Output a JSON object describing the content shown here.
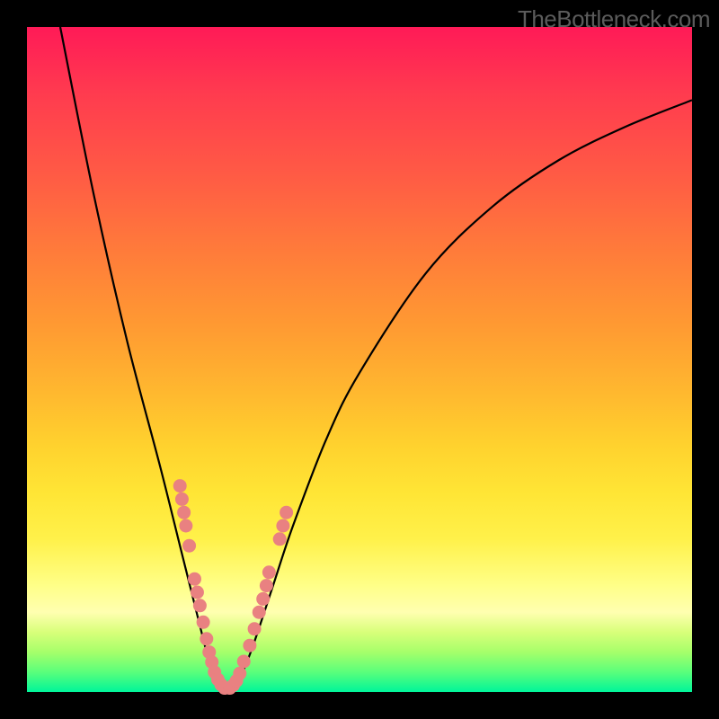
{
  "watermark": "TheBottleneck.com",
  "chart_data": {
    "type": "line",
    "title": "",
    "xlabel": "",
    "ylabel": "",
    "xlim": [
      0,
      100
    ],
    "ylim": [
      0,
      100
    ],
    "gradient_stops": [
      {
        "pos": 0,
        "color": "#ff1a57"
      },
      {
        "pos": 50,
        "color": "#ffb82f"
      },
      {
        "pos": 80,
        "color": "#ffff88"
      },
      {
        "pos": 100,
        "color": "#00f59a"
      }
    ],
    "series": [
      {
        "name": "bottleneck-curve",
        "points": [
          {
            "x": 5,
            "y": 100
          },
          {
            "x": 10,
            "y": 75
          },
          {
            "x": 15,
            "y": 53
          },
          {
            "x": 20,
            "y": 34
          },
          {
            "x": 23,
            "y": 22
          },
          {
            "x": 25,
            "y": 14
          },
          {
            "x": 27,
            "y": 6
          },
          {
            "x": 28,
            "y": 2
          },
          {
            "x": 29,
            "y": 0.5
          },
          {
            "x": 30,
            "y": 0
          },
          {
            "x": 31,
            "y": 0.5
          },
          {
            "x": 32,
            "y": 2
          },
          {
            "x": 34,
            "y": 7
          },
          {
            "x": 37,
            "y": 16
          },
          {
            "x": 40,
            "y": 25
          },
          {
            "x": 45,
            "y": 38
          },
          {
            "x": 50,
            "y": 48
          },
          {
            "x": 60,
            "y": 63
          },
          {
            "x": 70,
            "y": 73
          },
          {
            "x": 80,
            "y": 80
          },
          {
            "x": 90,
            "y": 85
          },
          {
            "x": 100,
            "y": 89
          }
        ]
      }
    ],
    "scatter": [
      {
        "x": 23.0,
        "y": 31
      },
      {
        "x": 23.3,
        "y": 29
      },
      {
        "x": 23.6,
        "y": 27
      },
      {
        "x": 23.9,
        "y": 25
      },
      {
        "x": 24.4,
        "y": 22
      },
      {
        "x": 25.2,
        "y": 17
      },
      {
        "x": 25.6,
        "y": 15
      },
      {
        "x": 26.0,
        "y": 13
      },
      {
        "x": 26.5,
        "y": 10.5
      },
      {
        "x": 27.0,
        "y": 8
      },
      {
        "x": 27.4,
        "y": 6
      },
      {
        "x": 27.8,
        "y": 4.5
      },
      {
        "x": 28.2,
        "y": 3
      },
      {
        "x": 28.7,
        "y": 1.9
      },
      {
        "x": 29.2,
        "y": 1.1
      },
      {
        "x": 29.7,
        "y": 0.6
      },
      {
        "x": 30.5,
        "y": 0.6
      },
      {
        "x": 31.0,
        "y": 1.0
      },
      {
        "x": 31.5,
        "y": 1.7
      },
      {
        "x": 32.0,
        "y": 2.8
      },
      {
        "x": 32.6,
        "y": 4.6
      },
      {
        "x": 33.5,
        "y": 7.0
      },
      {
        "x": 34.2,
        "y": 9.5
      },
      {
        "x": 34.9,
        "y": 12
      },
      {
        "x": 35.5,
        "y": 14
      },
      {
        "x": 36.0,
        "y": 16
      },
      {
        "x": 36.4,
        "y": 18
      },
      {
        "x": 38.0,
        "y": 23
      },
      {
        "x": 38.5,
        "y": 25
      },
      {
        "x": 39.0,
        "y": 27
      }
    ],
    "scatter_color": "#e98181",
    "curve_color": "#000000"
  }
}
